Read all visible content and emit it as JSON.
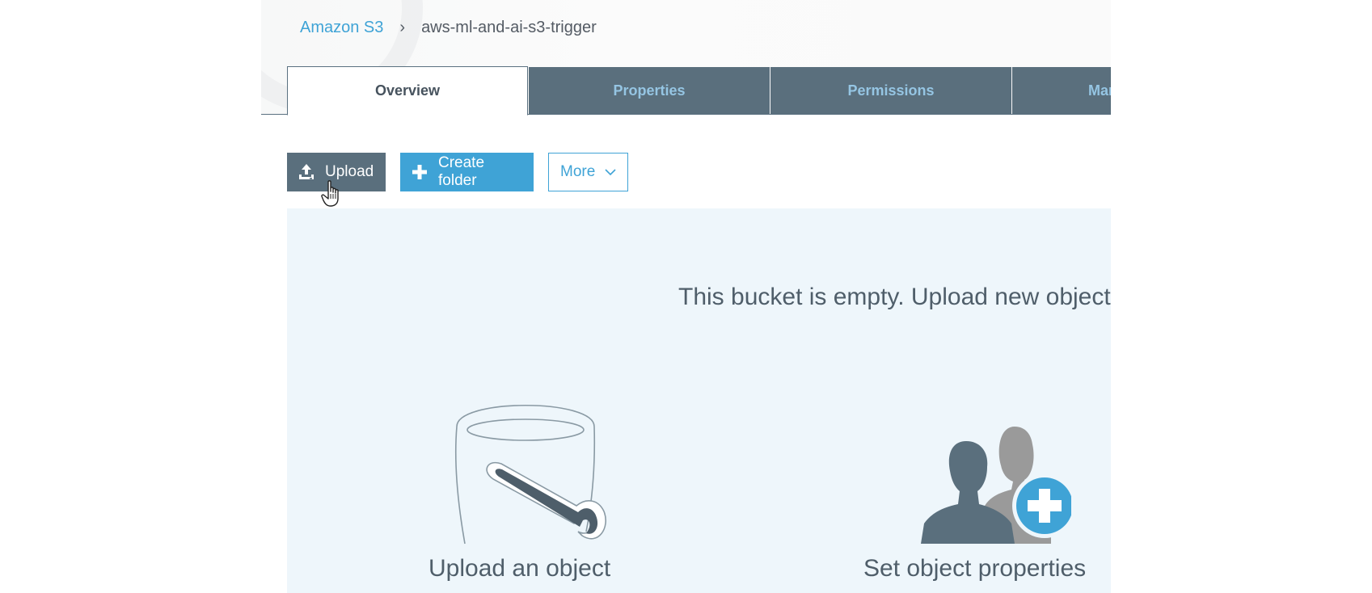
{
  "breadcrumb": {
    "root": "Amazon S3",
    "separator": "›",
    "current": "aws-ml-and-ai-s3-trigger"
  },
  "tabs": [
    {
      "label": "Overview",
      "active": true
    },
    {
      "label": "Properties",
      "active": false
    },
    {
      "label": "Permissions",
      "active": false
    },
    {
      "label": "Management",
      "active": false
    }
  ],
  "actions": {
    "upload_label": "Upload",
    "upload_icon": "upload-icon",
    "create_folder_label": "Create folder",
    "create_folder_icon": "plus-icon",
    "more_label": "More",
    "more_icon": "chevron-down-icon"
  },
  "empty_state": {
    "message": "This bucket is empty. Upload new objects",
    "cards": [
      {
        "title": "Upload an object",
        "icon": "bucket-icon"
      },
      {
        "title": "Set object properties",
        "icon": "add-user-icon"
      }
    ]
  },
  "colors": {
    "link": "#3fa3d6",
    "tab_inactive_bg": "#5a6f7d",
    "tab_inactive_text": "#95c5e3",
    "panel_bg": "#eef6fb",
    "text_dark": "#4f5e6a"
  }
}
